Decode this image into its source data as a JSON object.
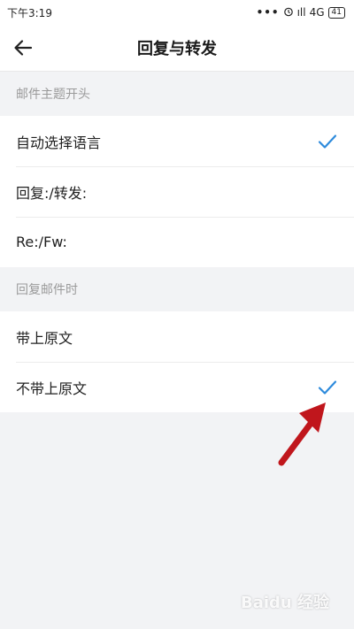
{
  "status": {
    "time": "下午3:19",
    "dots": "•••",
    "signal": "ıll",
    "network": "4G",
    "battery": "41"
  },
  "appbar": {
    "title": "回复与转发"
  },
  "sections": [
    {
      "header": "邮件主题开头",
      "items": [
        {
          "label": "自动选择语言",
          "checked": true
        },
        {
          "label": "回复:/转发:",
          "checked": false
        },
        {
          "label": "Re:/Fw:",
          "checked": false
        }
      ]
    },
    {
      "header": "回复邮件时",
      "items": [
        {
          "label": "带上原文",
          "checked": false
        },
        {
          "label": "不带上原文",
          "checked": true
        }
      ]
    }
  ],
  "colors": {
    "accent": "#2e8bdc",
    "annotation_arrow": "#c0161c",
    "background": "#f2f3f5"
  },
  "watermark": {
    "text": "Baidu 经验"
  }
}
